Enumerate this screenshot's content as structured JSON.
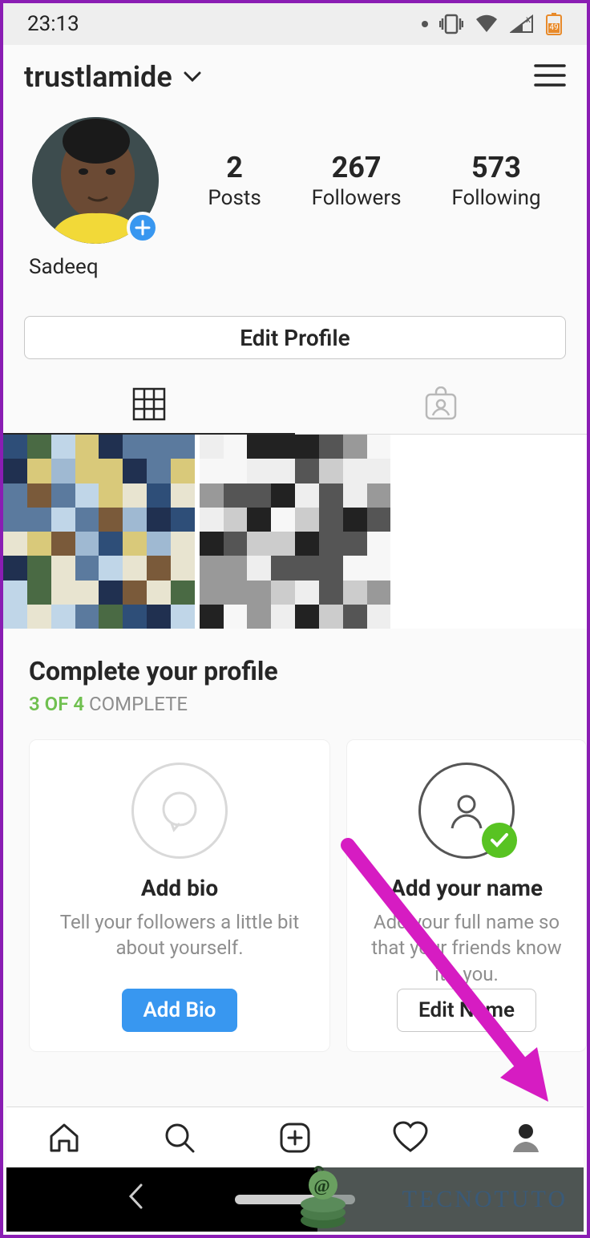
{
  "status": {
    "time": "23:13",
    "battery": "49"
  },
  "header": {
    "username": "trustlamide"
  },
  "profile": {
    "display_name": "Sadeeq",
    "stats": {
      "posts": {
        "count": "2",
        "label": "Posts"
      },
      "followers": {
        "count": "267",
        "label": "Followers"
      },
      "following": {
        "count": "573",
        "label": "Following"
      }
    }
  },
  "edit_profile_label": "Edit Profile",
  "complete": {
    "title": "Complete your profile",
    "progress_done": "3 OF 4",
    "progress_rest": " COMPLETE",
    "cards": [
      {
        "title": "Add bio",
        "desc": "Tell your followers a little bit about yourself.",
        "button": "Add Bio",
        "done": false
      },
      {
        "title": "Add your name",
        "desc": "Add your full name so that your friends know it's you.",
        "button": "Edit Name",
        "done": true
      }
    ]
  },
  "watermark": "TECNOTUTO"
}
